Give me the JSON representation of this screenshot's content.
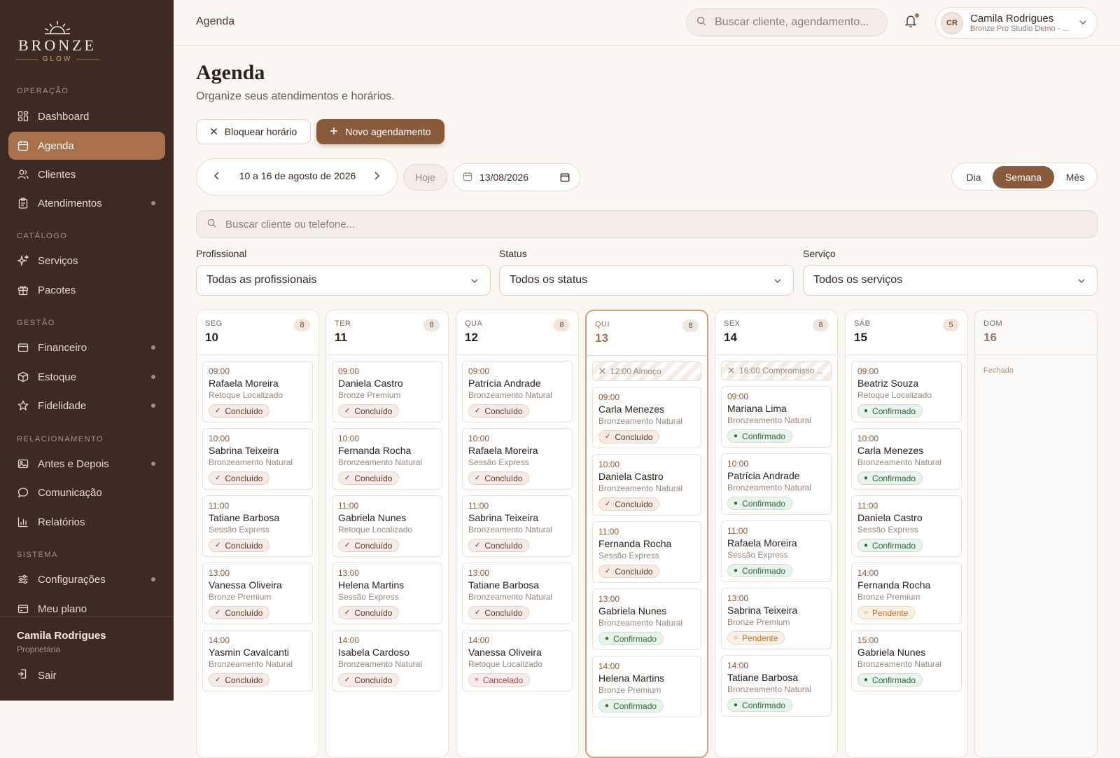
{
  "brand": {
    "name": "BRONZE",
    "sub": "GLOW"
  },
  "sidebar": {
    "sections": [
      "OPERAÇÃO",
      "CATÁLOGO",
      "GESTÃO",
      "RELACIONAMENTO",
      "SISTEMA"
    ],
    "items": [
      {
        "label": "Dashboard",
        "icon": "dashboard-icon"
      },
      {
        "label": "Agenda",
        "icon": "calendar-icon",
        "active": true
      },
      {
        "label": "Clientes",
        "icon": "users-icon"
      },
      {
        "label": "Atendimentos",
        "icon": "clipboard-icon",
        "dot": true
      },
      {
        "label": "Serviços",
        "icon": "sparkle-icon"
      },
      {
        "label": "Pacotes",
        "icon": "gift-icon"
      },
      {
        "label": "Financeiro",
        "icon": "wallet-icon",
        "dot": true
      },
      {
        "label": "Estoque",
        "icon": "box-icon",
        "dot": true
      },
      {
        "label": "Fidelidade",
        "icon": "star-icon",
        "dot": true
      },
      {
        "label": "Antes e Depois",
        "icon": "image-icon",
        "dot": true
      },
      {
        "label": "Comunicação",
        "icon": "chat-icon"
      },
      {
        "label": "Relatórios",
        "icon": "chart-icon"
      },
      {
        "label": "Configurações",
        "icon": "sliders-icon",
        "dot": true
      },
      {
        "label": "Meu plano",
        "icon": "card-icon"
      }
    ],
    "user": {
      "name": "Camila Rodrigues",
      "role": "Proprietária"
    },
    "logout": "Sair"
  },
  "topbar": {
    "breadcrumb": "Agenda",
    "search_placeholder": "Buscar cliente, agendamento...",
    "user": {
      "initials": "CR",
      "name": "Camila Rodrigues",
      "studio": "Bronze Pro Studio Demo - ..."
    }
  },
  "page": {
    "title": "Agenda",
    "subtitle": "Organize seus atendimentos e horários.",
    "block_button": "Bloquear horário",
    "new_button": "Novo agendamento",
    "week_label": "10 a 16 de agosto de 2026",
    "today_button": "Hoje",
    "date_value": "13/08/2026",
    "views": [
      "Dia",
      "Semana",
      "Mês"
    ],
    "active_view": "Semana",
    "search_placeholder": "Buscar cliente ou telefone..."
  },
  "filters": [
    {
      "label": "Profissional",
      "value": "Todas as profissionais"
    },
    {
      "label": "Status",
      "value": "Todos os status"
    },
    {
      "label": "Serviço",
      "value": "Todos os serviços"
    }
  ],
  "status_colors": {
    "Concluído": "#f6ece5",
    "Confirmado": "#e9f4ec",
    "Pendente": "#fcf1e2",
    "Cancelado": "#fbeceb"
  },
  "days": [
    {
      "weekday": "SEG",
      "day": "10",
      "count": "8",
      "blocks": [],
      "appointments": [
        {
          "time": "09:00",
          "client": "Rafaela Moreira",
          "service": "Retoque Localizado",
          "status": "Concluído"
        },
        {
          "time": "10:00",
          "client": "Sabrina Teixeira",
          "service": "Bronzeamento Natural",
          "status": "Concluído"
        },
        {
          "time": "11:00",
          "client": "Tatiane Barbosa",
          "service": "Sessão Express",
          "status": "Concluído"
        },
        {
          "time": "13:00",
          "client": "Vanessa Oliveira",
          "service": "Bronze Premium",
          "status": "Concluído"
        },
        {
          "time": "14:00",
          "client": "Yasmin Cavalcanti",
          "service": "Bronzeamento Natural",
          "status": "Concluído"
        }
      ]
    },
    {
      "weekday": "TER",
      "day": "11",
      "count": "8",
      "blocks": [],
      "appointments": [
        {
          "time": "09:00",
          "client": "Daniela Castro",
          "service": "Bronze Premium",
          "status": "Concluído"
        },
        {
          "time": "10:00",
          "client": "Fernanda Rocha",
          "service": "Bronzeamento Natural",
          "status": "Concluído"
        },
        {
          "time": "11:00",
          "client": "Gabriela Nunes",
          "service": "Retoque Localizado",
          "status": "Concluído"
        },
        {
          "time": "13:00",
          "client": "Helena Martins",
          "service": "Sessão Express",
          "status": "Concluído"
        },
        {
          "time": "14:00",
          "client": "Isabela Cardoso",
          "service": "Bronzeamento Natural",
          "status": "Concluído"
        }
      ]
    },
    {
      "weekday": "QUA",
      "day": "12",
      "count": "8",
      "blocks": [],
      "appointments": [
        {
          "time": "09:00",
          "client": "Patrícia Andrade",
          "service": "Bronzeamento Natural",
          "status": "Concluído"
        },
        {
          "time": "10:00",
          "client": "Rafaela Moreira",
          "service": "Sessão Express",
          "status": "Concluído"
        },
        {
          "time": "11:00",
          "client": "Sabrina Teixeira",
          "service": "Bronzeamento Natural",
          "status": "Concluído"
        },
        {
          "time": "13:00",
          "client": "Tatiane Barbosa",
          "service": "Bronzeamento Natural",
          "status": "Concluído"
        },
        {
          "time": "14:00",
          "client": "Vanessa Oliveira",
          "service": "Retoque Localizado",
          "status": "Cancelado"
        }
      ]
    },
    {
      "weekday": "QUI",
      "day": "13",
      "count": "8",
      "today": true,
      "blocks": [
        "12:00 Almoço"
      ],
      "appointments": [
        {
          "time": "09:00",
          "client": "Carla Menezes",
          "service": "Bronzeamento Natural",
          "status": "Concluído"
        },
        {
          "time": "10:00",
          "client": "Daniela Castro",
          "service": "Bronzeamento Natural",
          "status": "Concluído"
        },
        {
          "time": "11:00",
          "client": "Fernanda Rocha",
          "service": "Sessão Express",
          "status": "Concluído"
        },
        {
          "time": "13:00",
          "client": "Gabriela Nunes",
          "service": "Bronzeamento Natural",
          "status": "Confirmado"
        },
        {
          "time": "14:00",
          "client": "Helena Martins",
          "service": "Bronze Premium",
          "status": "Confirmado"
        }
      ]
    },
    {
      "weekday": "SEX",
      "day": "14",
      "count": "8",
      "blocks": [
        "16:00 Compromisso ..."
      ],
      "appointments": [
        {
          "time": "09:00",
          "client": "Mariana Lima",
          "service": "Bronzeamento Natural",
          "status": "Confirmado"
        },
        {
          "time": "10:00",
          "client": "Patrícia Andrade",
          "service": "Bronzeamento Natural",
          "status": "Confirmado"
        },
        {
          "time": "11:00",
          "client": "Rafaela Moreira",
          "service": "Sessão Express",
          "status": "Confirmado"
        },
        {
          "time": "13:00",
          "client": "Sabrina Teixeira",
          "service": "Bronze Premium",
          "status": "Pendente"
        },
        {
          "time": "14:00",
          "client": "Tatiane Barbosa",
          "service": "Bronzeamento Natural",
          "status": "Confirmado"
        }
      ]
    },
    {
      "weekday": "SÁB",
      "day": "15",
      "count": "5",
      "blocks": [],
      "appointments": [
        {
          "time": "09:00",
          "client": "Beatriz Souza",
          "service": "Retoque Localizado",
          "status": "Confirmado"
        },
        {
          "time": "10:00",
          "client": "Carla Menezes",
          "service": "Bronzeamento Natural",
          "status": "Confirmado"
        },
        {
          "time": "11:00",
          "client": "Daniela Castro",
          "service": "Sessão Express",
          "status": "Confirmado"
        },
        {
          "time": "14:00",
          "client": "Fernanda Rocha",
          "service": "Bronze Premium",
          "status": "Pendente"
        },
        {
          "time": "15:00",
          "client": "Gabriela Nunes",
          "service": "Bronzeamento Natural",
          "status": "Confirmado"
        }
      ]
    },
    {
      "weekday": "DOM",
      "day": "16",
      "closed": true,
      "closed_label": "Fechado",
      "blocks": [],
      "appointments": []
    }
  ]
}
